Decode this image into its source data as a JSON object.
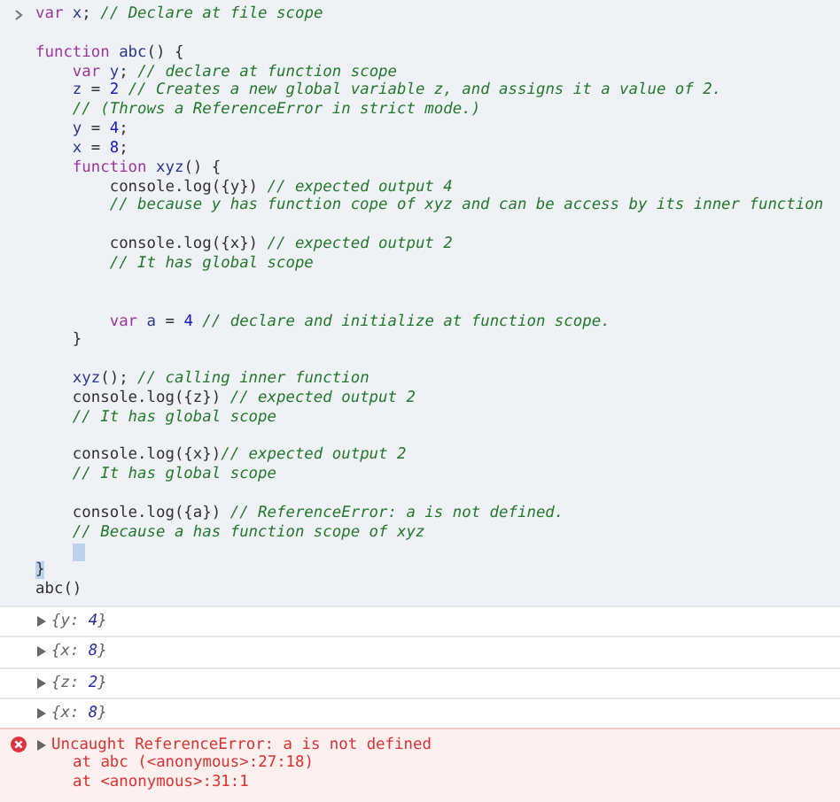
{
  "input": {
    "lines": [
      {
        "segments": [
          {
            "kind": "keyword",
            "text": "var"
          },
          {
            "kind": "name",
            "text": " x"
          },
          {
            "kind": "plain",
            "text": "; "
          },
          {
            "kind": "comment",
            "text": "// Declare at file scope"
          }
        ]
      },
      {
        "kind": "blank"
      },
      {
        "segments": [
          {
            "kind": "keyword",
            "text": "function"
          },
          {
            "kind": "name",
            "text": " abc"
          },
          {
            "kind": "plain",
            "text": "() {"
          }
        ]
      },
      {
        "segments": [
          {
            "kind": "keyword",
            "text": "    var"
          },
          {
            "kind": "name",
            "text": " y"
          },
          {
            "kind": "plain",
            "text": "; "
          },
          {
            "kind": "comment",
            "text": "// declare at function scope"
          }
        ]
      },
      {
        "segments": [
          {
            "kind": "name",
            "text": "    z"
          },
          {
            "kind": "plain",
            "text": " = "
          },
          {
            "kind": "number",
            "text": "2"
          },
          {
            "kind": "comment",
            "text": " // Creates a new global variable z, and assigns it a value of 2."
          }
        ]
      },
      {
        "segments": [
          {
            "kind": "comment",
            "text": "    // (Throws a ReferenceError in strict mode.)"
          }
        ]
      },
      {
        "segments": [
          {
            "kind": "name",
            "text": "    y"
          },
          {
            "kind": "plain",
            "text": " = "
          },
          {
            "kind": "number",
            "text": "4"
          },
          {
            "kind": "plain",
            "text": ";"
          }
        ]
      },
      {
        "segments": [
          {
            "kind": "name",
            "text": "    x"
          },
          {
            "kind": "plain",
            "text": " = "
          },
          {
            "kind": "number",
            "text": "8"
          },
          {
            "kind": "plain",
            "text": ";"
          }
        ]
      },
      {
        "segments": [
          {
            "kind": "keyword",
            "text": "    function"
          },
          {
            "kind": "name",
            "text": " xyz"
          },
          {
            "kind": "plain",
            "text": "() {"
          }
        ]
      },
      {
        "segments": [
          {
            "kind": "plain",
            "text": "        console.log({y}) "
          },
          {
            "kind": "comment",
            "text": "// expected output 4"
          }
        ]
      },
      {
        "segments": [
          {
            "kind": "comment",
            "text": "        // because y has function cope of xyz and can be access by its inner function"
          }
        ]
      },
      {
        "kind": "blank"
      },
      {
        "segments": [
          {
            "kind": "plain",
            "text": "        console.log({x}) "
          },
          {
            "kind": "comment",
            "text": "// expected output 2"
          }
        ]
      },
      {
        "segments": [
          {
            "kind": "comment",
            "text": "        // It has global scope"
          }
        ]
      },
      {
        "kind": "blank"
      },
      {
        "kind": "blank"
      },
      {
        "segments": [
          {
            "kind": "keyword",
            "text": "        var"
          },
          {
            "kind": "name",
            "text": " a"
          },
          {
            "kind": "plain",
            "text": " = "
          },
          {
            "kind": "number",
            "text": "4"
          },
          {
            "kind": "comment",
            "text": " // declare and initialize at function scope."
          }
        ]
      },
      {
        "segments": [
          {
            "kind": "plain",
            "text": "    }"
          }
        ]
      },
      {
        "kind": "blank"
      },
      {
        "segments": [
          {
            "kind": "name",
            "text": "    xyz"
          },
          {
            "kind": "plain",
            "text": "(); "
          },
          {
            "kind": "comment",
            "text": "// calling inner function"
          }
        ]
      },
      {
        "segments": [
          {
            "kind": "plain",
            "text": "    console.log({z}) "
          },
          {
            "kind": "comment",
            "text": "// expected output 2"
          }
        ]
      },
      {
        "segments": [
          {
            "kind": "comment",
            "text": "    // It has global scope"
          }
        ]
      },
      {
        "kind": "blank"
      },
      {
        "segments": [
          {
            "kind": "plain",
            "text": "    console.log({x})"
          },
          {
            "kind": "comment",
            "text": "// expected output 2"
          }
        ]
      },
      {
        "segments": [
          {
            "kind": "comment",
            "text": "    // It has global scope"
          }
        ]
      },
      {
        "kind": "blank"
      },
      {
        "segments": [
          {
            "kind": "plain",
            "text": "    console.log({a}) "
          },
          {
            "kind": "comment",
            "text": "// ReferenceError: a is not defined."
          }
        ]
      },
      {
        "segments": [
          {
            "kind": "comment",
            "text": "    // Because a has function scope of xyz"
          }
        ]
      },
      {
        "kind": "cursor"
      },
      {
        "segments": [
          {
            "kind": "bracket-match",
            "text": "}"
          }
        ]
      },
      {
        "segments": [
          {
            "kind": "plain",
            "text": "abc()"
          }
        ]
      }
    ]
  },
  "outputs": [
    {
      "expanded": false,
      "segments": [
        {
          "kind": "plain",
          "text": "{y: "
        },
        {
          "kind": "number",
          "text": "4"
        },
        {
          "kind": "plain",
          "text": "}"
        }
      ]
    },
    {
      "expanded": false,
      "segments": [
        {
          "kind": "plain",
          "text": "{x: "
        },
        {
          "kind": "number",
          "text": "8"
        },
        {
          "kind": "plain",
          "text": "}"
        }
      ]
    },
    {
      "expanded": false,
      "segments": [
        {
          "kind": "plain",
          "text": "{z: "
        },
        {
          "kind": "number",
          "text": "2"
        },
        {
          "kind": "plain",
          "text": "}"
        }
      ]
    },
    {
      "expanded": false,
      "segments": [
        {
          "kind": "plain",
          "text": "{x: "
        },
        {
          "kind": "number",
          "text": "8"
        },
        {
          "kind": "plain",
          "text": "}"
        }
      ]
    }
  ],
  "error": {
    "expanded": false,
    "message": "Uncaught ReferenceError: a is not defined",
    "stack": [
      "at abc (<anonymous>:27:18)",
      "at <anonymous>:31:1"
    ]
  }
}
